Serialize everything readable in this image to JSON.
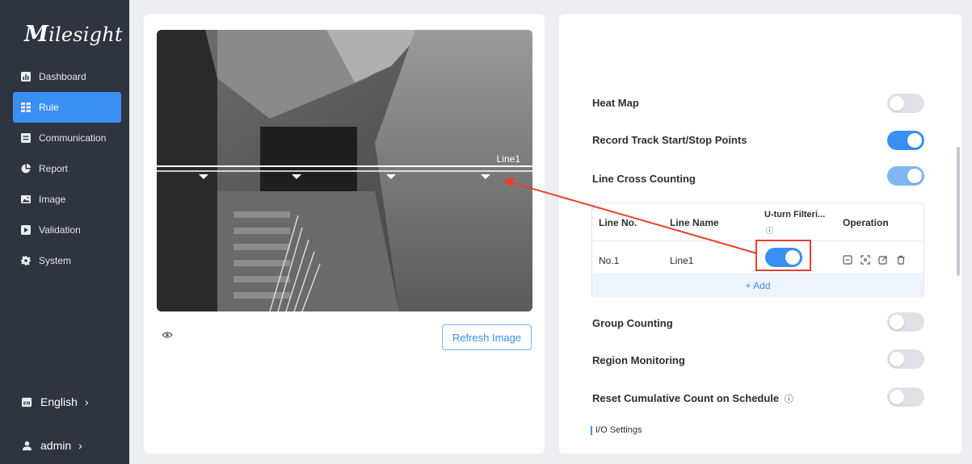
{
  "brand": {
    "logo_text": "Milesight"
  },
  "sidebar": {
    "items": [
      {
        "label": "Dashboard",
        "icon": "dashboard-icon",
        "active": false
      },
      {
        "label": "Rule",
        "icon": "rule-icon",
        "active": true
      },
      {
        "label": "Communication",
        "icon": "communication-icon",
        "active": false
      },
      {
        "label": "Report",
        "icon": "report-icon",
        "active": false
      },
      {
        "label": "Image",
        "icon": "image-icon",
        "active": false
      },
      {
        "label": "Validation",
        "icon": "validation-icon",
        "active": false
      },
      {
        "label": "System",
        "icon": "gear-icon",
        "active": false
      }
    ],
    "language": {
      "label": "English",
      "chevron": "›",
      "icon": "language-icon"
    },
    "user": {
      "label": "admin",
      "chevron": "›",
      "icon": "user-icon"
    }
  },
  "preview": {
    "line_label": "Line1",
    "refresh_button": "Refresh Image",
    "eye_icon": "eye-icon"
  },
  "settings": {
    "heat_map": {
      "label": "Heat Map",
      "enabled": false
    },
    "record_track": {
      "label": "Record Track Start/Stop Points",
      "enabled": true
    },
    "line_cross": {
      "label": "Line Cross Counting",
      "enabled": true
    },
    "group_counting": {
      "label": "Group Counting",
      "enabled": false
    },
    "region_monitoring": {
      "label": "Region Monitoring",
      "enabled": false
    },
    "reset_cumulative": {
      "label": "Reset Cumulative Count on Schedule",
      "info": "ⓘ",
      "enabled": false
    },
    "io_settings": {
      "label": "I/O Settings"
    }
  },
  "line_table": {
    "headers": {
      "line_no": "Line No.",
      "line_name": "Line Name",
      "uturn": "U-turn Filteri...",
      "uturn_info": "ⓘ",
      "operation": "Operation"
    },
    "rows": [
      {
        "line_no": "No.1",
        "line_name": "Line1",
        "uturn_enabled": true
      }
    ],
    "add_label": "+ Add"
  },
  "colors": {
    "accent": "#3a8ff2",
    "sidebar_bg": "#2e3440",
    "highlight_red": "#e4402f"
  }
}
